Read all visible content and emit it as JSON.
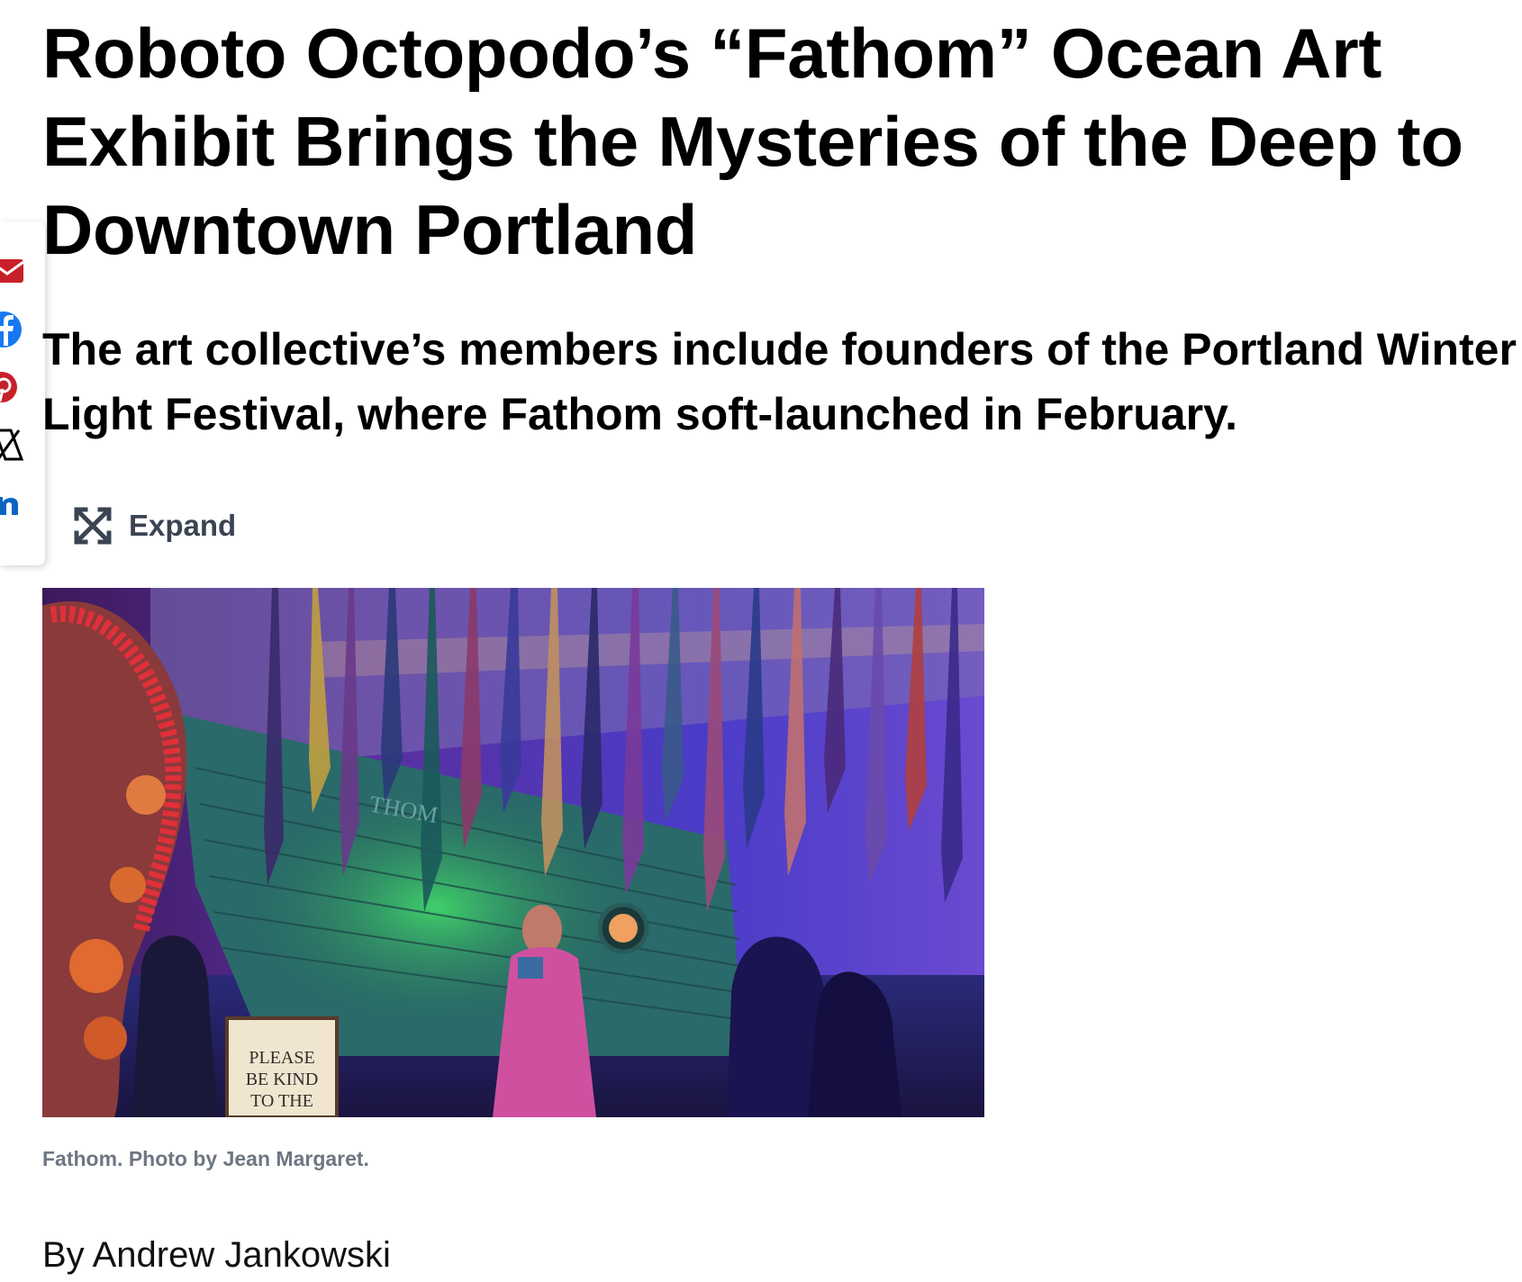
{
  "article": {
    "headline": "Roboto Octopodo’s “Fathom” Ocean Art Exhibit Brings the Mysteries of the Deep to Downtown Portland",
    "dek": "The art collective’s members include founders of the Portland Winter Light Festival, where Fathom soft-launched in February.",
    "expand_label": "Expand",
    "image": {
      "sign_lines": [
        "PLEASE",
        "BE KIND",
        "TO THE"
      ],
      "ship_lettering": "THOM"
    },
    "caption": "Fathom. Photo by Jean Margaret.",
    "byline": "By Andrew Jankowski"
  },
  "share": {
    "items": [
      {
        "icon": "email-icon",
        "color": "#c8202a"
      },
      {
        "icon": "facebook-icon",
        "color": "#1877f2"
      },
      {
        "icon": "pinterest-icon",
        "color": "#c8202a"
      },
      {
        "icon": "x-icon",
        "color": "#000000"
      },
      {
        "icon": "linkedin-icon",
        "color": "#0a66c2"
      }
    ]
  }
}
